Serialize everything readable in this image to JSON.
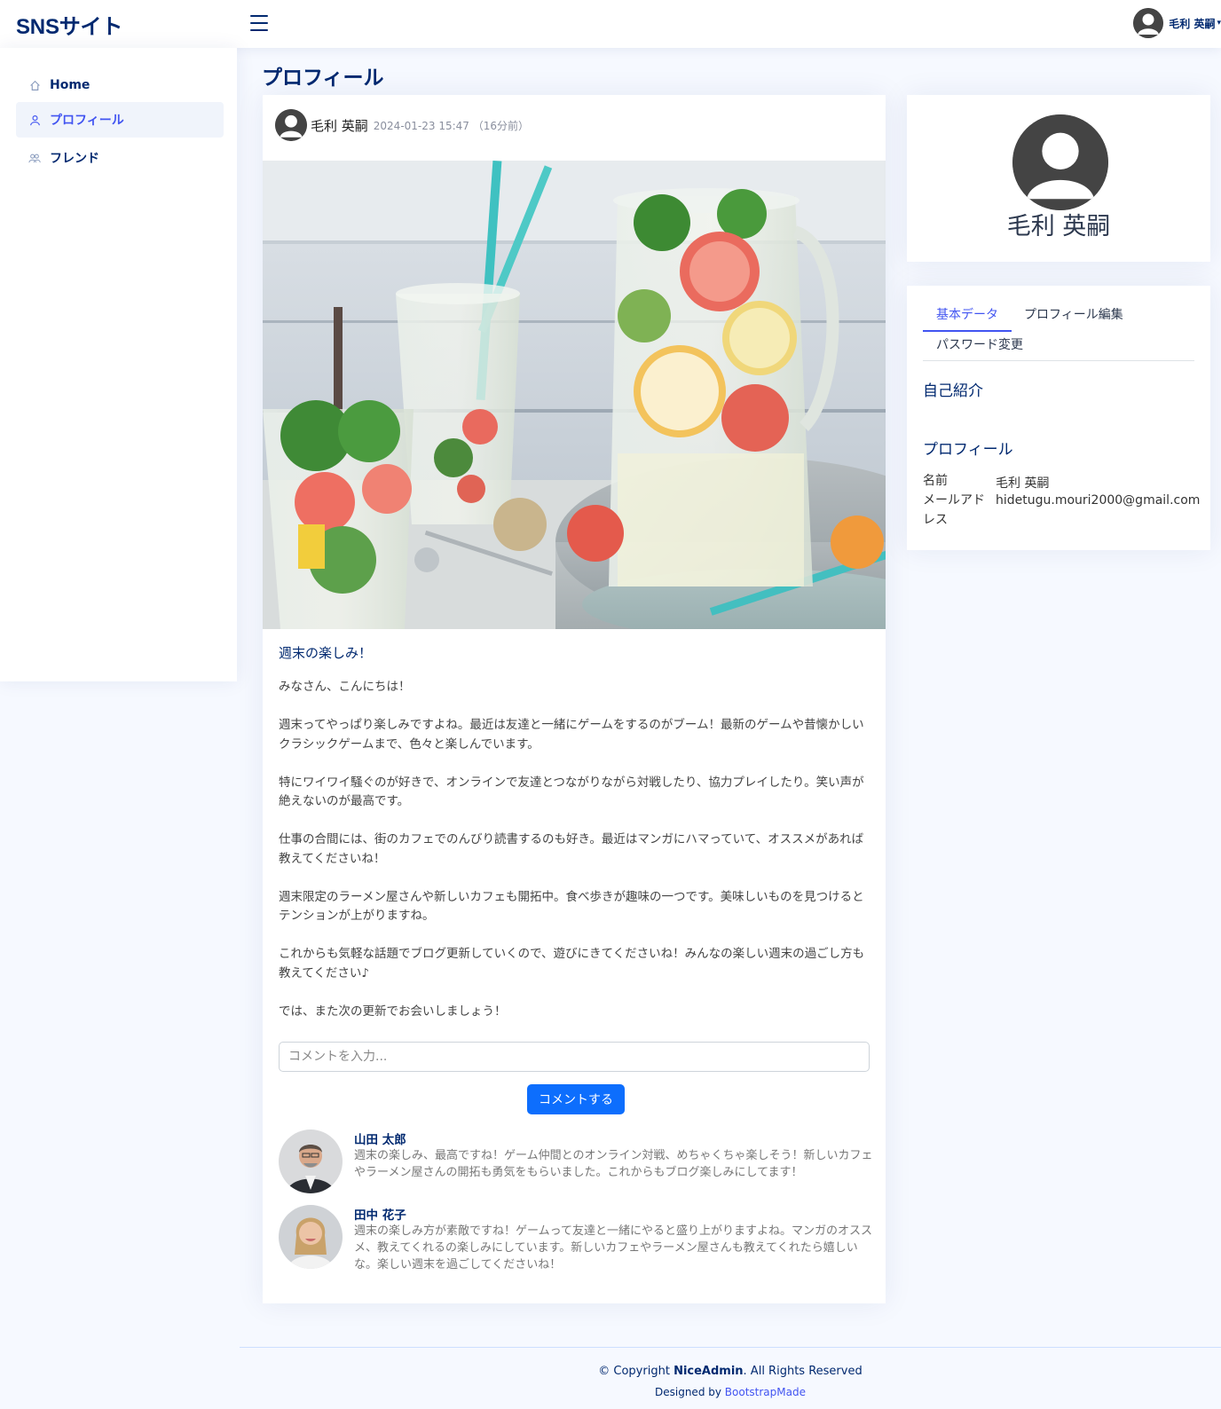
{
  "header": {
    "logo": "SNSサイト",
    "user_name": "毛利 英嗣"
  },
  "sidebar": {
    "items": [
      {
        "label": "Home",
        "icon": "house-icon"
      },
      {
        "label": "プロフィール",
        "icon": "person-icon"
      },
      {
        "label": "フレンド",
        "icon": "people-icon"
      }
    ],
    "active_index": 1
  },
  "page_title": "プロフィール",
  "post": {
    "author": "毛利 英嗣",
    "timestamp": "2024-01-23 15:47 （16分前）",
    "title": "週末の楽しみ！",
    "paragraphs": [
      "みなさん、こんにちは！",
      "週末ってやっぱり楽しみですよね。最近は友達と一緒にゲームをするのがブーム！最新のゲームや昔懐かしいクラシックゲームまで、色々と楽しんでいます。",
      "特にワイワイ騒ぐのが好きで、オンラインで友達とつながりながら対戦したり、協力プレイしたり。笑い声が絶えないのが最高です。",
      "仕事の合間には、街のカフェでのんびり読書するのも好き。最近はマンガにハマっていて、オススメがあれば教えてくださいね！",
      "週末限定のラーメン屋さんや新しいカフェも開拓中。食べ歩きが趣味の一つです。美味しいものを見つけるとテンションが上がりますね。",
      "これからも気軽な話題でブログ更新していくので、遊びにきてくださいね！みんなの楽しい週末の過ごし方も教えてください♪",
      "では、また次の更新でお会いしましょう！"
    ],
    "comment_placeholder": "コメントを入力...",
    "comment_button": "コメントする",
    "comments": [
      {
        "name": "山田 太郎",
        "text": "週末の楽しみ、最高ですね！ゲーム仲間とのオンライン対戦、めちゃくちゃ楽しそう！新しいカフェやラーメン屋さんの開拓も勇気をもらいました。これからもブログ楽しみにしてます！"
      },
      {
        "name": "田中 花子",
        "text": "週末の楽しみ方が素敵ですね！ゲームって友達と一緒にやると盛り上がりますよね。マンガのオススメ、教えてくれるの楽しみにしています。新しいカフェやラーメン屋さんも教えてくれたら嬉しいな。楽しい週末を過ごしてくださいね！"
      }
    ]
  },
  "profile_card": {
    "name": "毛利 英嗣"
  },
  "data_card": {
    "tabs": [
      "基本データ",
      "プロフィール編集",
      "パスワード変更"
    ],
    "active_tab": 0,
    "intro_heading": "自己紹介",
    "profile_heading": "プロフィール",
    "name_label": "名前",
    "name_value": "毛利 英嗣",
    "email_label": "メールアドレス",
    "email_value": "hidetugu.mouri2000@gmail.com"
  },
  "footer": {
    "copyright_prefix": "© Copyright ",
    "brand": "NiceAdmin",
    "copyright_suffix": ". All Rights Reserved",
    "designed_by": "Designed by ",
    "designer": "BootstrapMade"
  }
}
